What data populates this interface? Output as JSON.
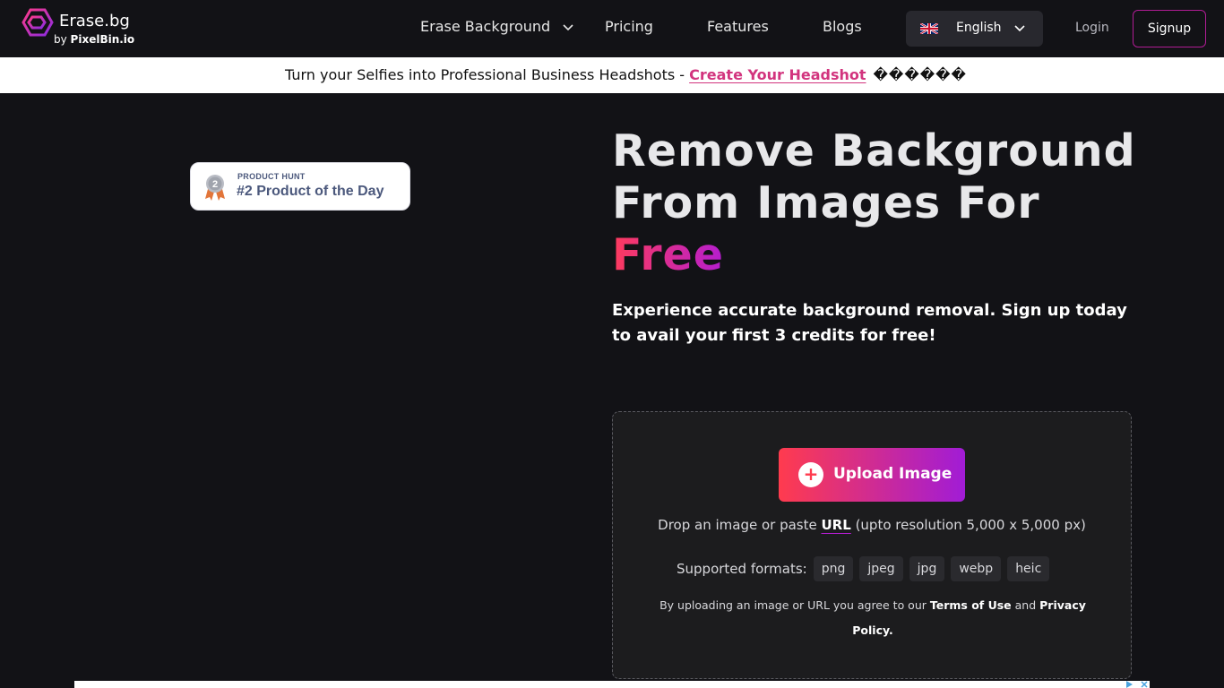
{
  "header": {
    "logo": {
      "name": "Erase.bg",
      "sub_prefix": "by ",
      "sub_brand": "PixelBin.io"
    },
    "nav": {
      "erase_background": "Erase Background",
      "pricing": "Pricing",
      "features": "Features",
      "blogs": "Blogs"
    },
    "language": {
      "flag_icon": "uk-flag-icon",
      "label": "English"
    },
    "login": "Login",
    "signup": "Signup"
  },
  "banner": {
    "text": "Turn your Selfies into Professional Business Headshots - ",
    "link": "Create Your Headshot",
    "emoji": "������"
  },
  "product_hunt": {
    "kicker": "PRODUCT HUNT",
    "title": "#2 Product of the Day",
    "medal_number": "2"
  },
  "hero": {
    "title_line1": "Remove Background",
    "title_line2": "From Images For",
    "title_highlight": "Free",
    "subtitle": "Experience accurate background removal. Sign up today to avail your first 3 credits for free!"
  },
  "upload": {
    "button_label": "Upload Image",
    "drop_prefix": "Drop an image or paste ",
    "drop_link": "URL",
    "drop_suffix": " (upto resolution 5,000 x 5,000 px)",
    "formats_label": "Supported formats:",
    "formats": [
      "png",
      "jpeg",
      "jpg",
      "webp",
      "heic"
    ],
    "terms_prefix": "By uploading an image or URL you agree to our ",
    "terms_link": "Terms of Use",
    "terms_and": " and ",
    "privacy_link": "Privacy Policy."
  },
  "colors": {
    "background": "#121216",
    "accent_start": "#ff3b4e",
    "accent_end": "#a11cd6",
    "banner_link": "#d2347e"
  }
}
